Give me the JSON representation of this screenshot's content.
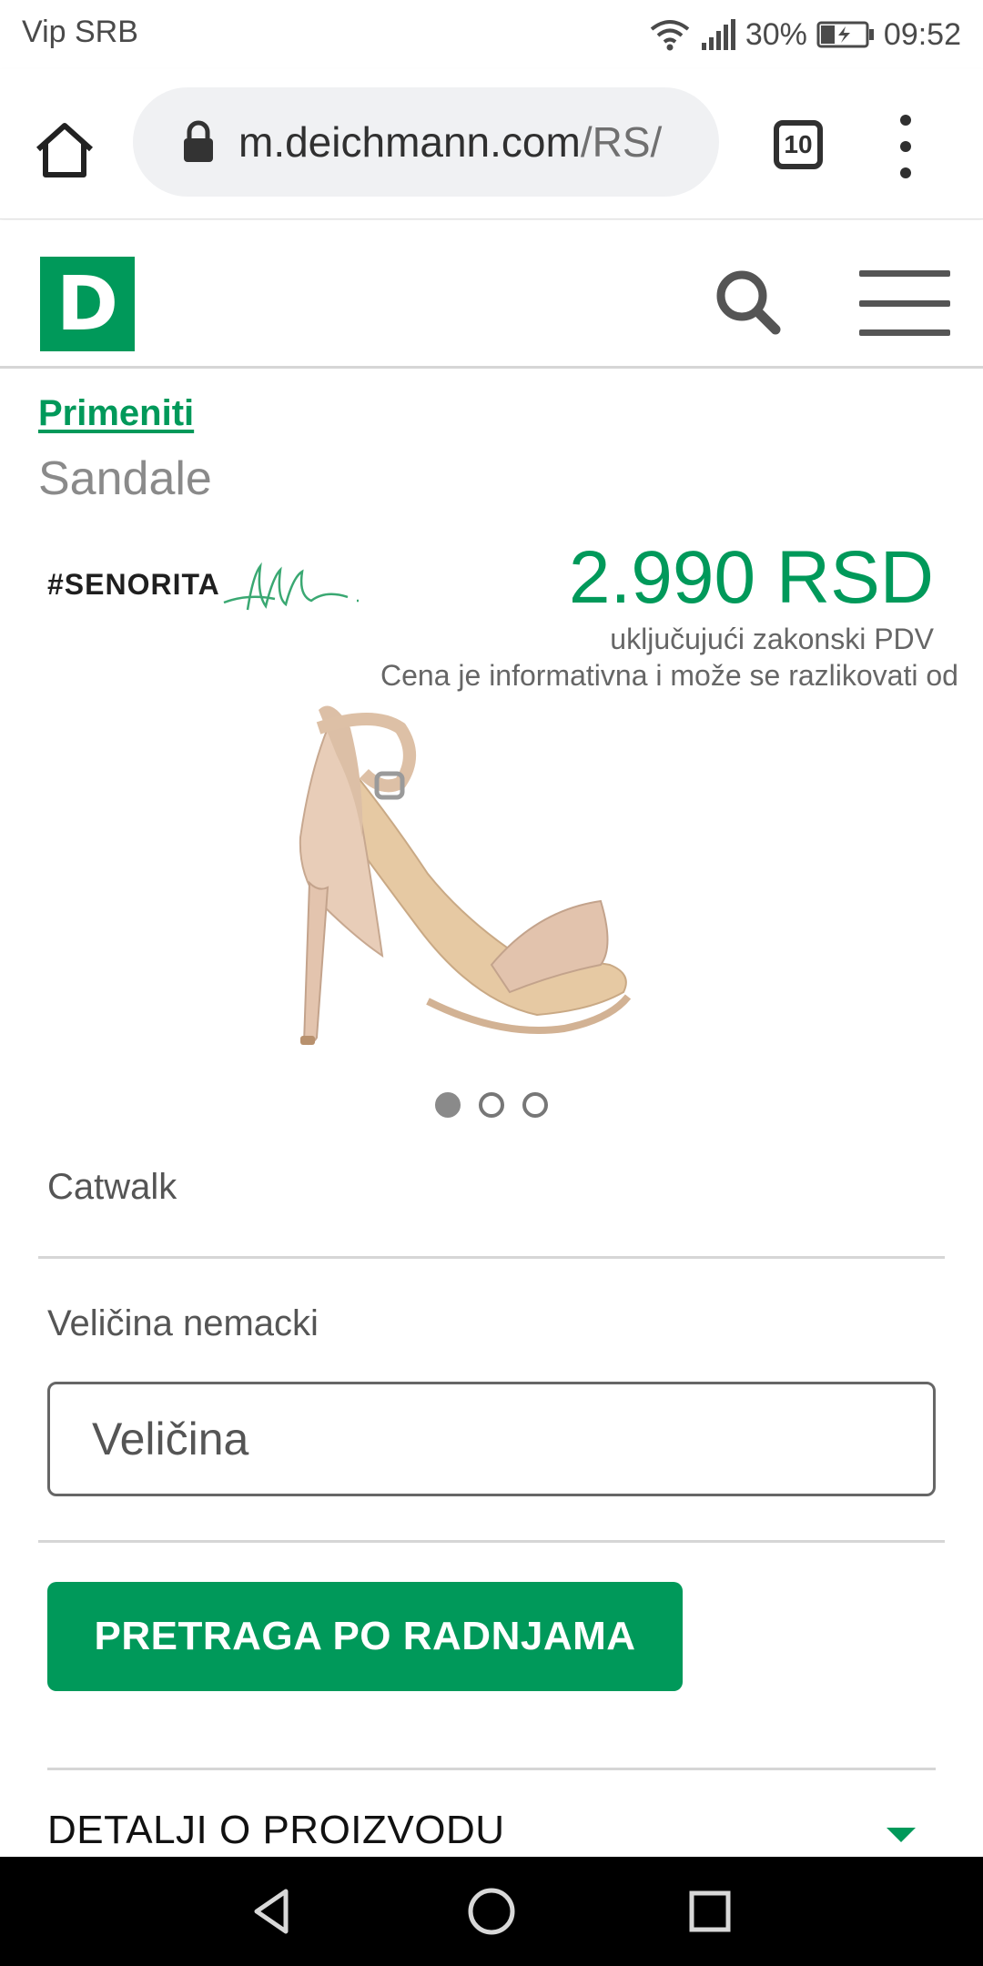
{
  "status_bar": {
    "carrier": "Vip SRB",
    "battery": "30%",
    "time": "09:52"
  },
  "browser": {
    "url_domain": "m.deichmann.com",
    "url_path": "/RS/",
    "tab_count": "10"
  },
  "site": {
    "logo_letter": "D",
    "brand_color": "#00995a"
  },
  "product": {
    "breadcrumb": "Primeniti",
    "title": "Sandale",
    "brand_logo_text": "#SENORITA",
    "price": "2.990 RSD",
    "vat_note": "uključujući zakonski PDV",
    "price_disclaimer": "Cena je informativna i može se razlikovati od",
    "brand": "Catwalk",
    "image_dots": {
      "count": 3,
      "active": 0
    }
  },
  "size": {
    "label": "Veličina nemacki",
    "placeholder": "Veličina"
  },
  "actions": {
    "store_search_label": "PRETRAGA PO RADNJAMA",
    "details_label": "DETALJI O PROIZVODU"
  },
  "icons": {
    "home": "home-icon",
    "lock": "lock-icon",
    "search": "search-icon",
    "hamburger": "hamburger-menu-icon",
    "overflow": "more-vert-icon",
    "chevron": "chevron-down-icon",
    "nav_back": "back-triangle-icon",
    "nav_home": "home-circle-icon",
    "nav_recents": "recents-square-icon"
  }
}
